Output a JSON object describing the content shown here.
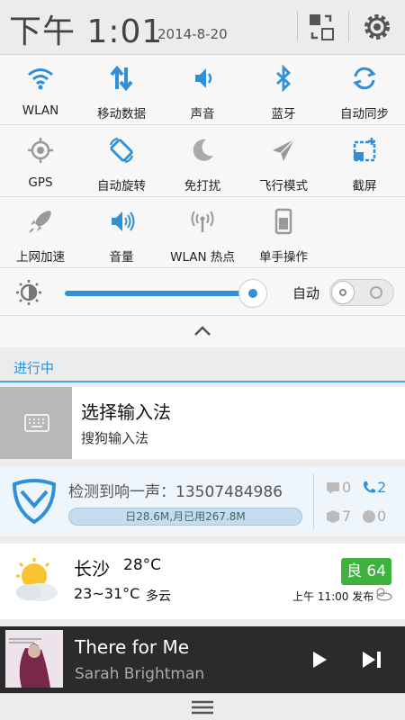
{
  "header": {
    "time": "下午 1:01",
    "date": "2014-8-20",
    "switch_icon": "switch-view-icon",
    "settings_icon": "gear-icon"
  },
  "quick_settings": {
    "tiles": [
      {
        "label": "WLAN",
        "icon": "wifi-icon",
        "active": true
      },
      {
        "label": "移动数据",
        "icon": "mobile-data-icon",
        "active": true
      },
      {
        "label": "声音",
        "icon": "speaker-icon",
        "active": true
      },
      {
        "label": "蓝牙",
        "icon": "bluetooth-icon",
        "active": true
      },
      {
        "label": "自动同步",
        "icon": "sync-icon",
        "active": true
      },
      {
        "label": "GPS",
        "icon": "gps-icon",
        "active": false
      },
      {
        "label": "自动旋转",
        "icon": "rotate-icon",
        "active": true
      },
      {
        "label": "免打扰",
        "icon": "moon-icon",
        "active": false
      },
      {
        "label": "飞行模式",
        "icon": "airplane-icon",
        "active": false
      },
      {
        "label": "截屏",
        "icon": "screenshot-icon",
        "active": true
      },
      {
        "label": "上网加速",
        "icon": "rocket-icon",
        "active": false
      },
      {
        "label": "音量",
        "icon": "volume-icon",
        "active": true
      },
      {
        "label": "WLAN 热点",
        "icon": "hotspot-icon",
        "active": false
      },
      {
        "label": "单手操作",
        "icon": "one-hand-icon",
        "active": false
      }
    ],
    "brightness": {
      "level": 0.95,
      "auto_label": "自动",
      "auto_on": false
    }
  },
  "ongoing": {
    "section_title": "进行中",
    "ime": {
      "title": "选择输入法",
      "subtitle": "搜狗输入法"
    },
    "security": {
      "title": "检测到响一声：13507484986",
      "data_usage": "日28.6M,月已用267.8M",
      "messages": "0",
      "calls": "2",
      "box_count": "7",
      "other_count": "0"
    },
    "weather": {
      "city": "长沙",
      "temp": "28°C",
      "range": "23~31°C",
      "condition": "多云",
      "aqi": "良 64",
      "published": "上午 11:00 发布"
    },
    "music": {
      "song": "There for Me",
      "artist": "Sarah Brightman"
    }
  },
  "colors": {
    "accent": "#2f8fd8",
    "aqi_good": "#3db33d"
  }
}
